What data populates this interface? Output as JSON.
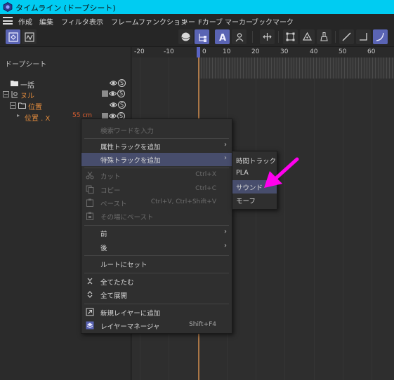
{
  "window": {
    "title": "タイムライン (ドープシート)"
  },
  "menubar": {
    "items": [
      "作成",
      "編集",
      "フィルタ",
      "表示",
      "フレーム",
      "ファンクション",
      "キー",
      "Fカーブ",
      "マーカー",
      "ブックマーク"
    ]
  },
  "panel": {
    "title": "ドープシート",
    "rows": [
      {
        "label": "一括"
      },
      {
        "label": "ヌル"
      },
      {
        "label": "位置"
      },
      {
        "label": "位置 . X",
        "value": "55 cm"
      }
    ],
    "s_glyph": "S"
  },
  "ruler": {
    "ticks": [
      "-20",
      "-10",
      "0",
      "10",
      "20",
      "30",
      "40",
      "50",
      "60"
    ]
  },
  "context_menu": {
    "search_placeholder": "検索ワードを入力",
    "items": [
      {
        "label": "属性トラックを追加",
        "submenu": true
      },
      {
        "label": "特殊トラックを追加",
        "submenu": true,
        "highlighted": true
      },
      {
        "label": "カット",
        "shortcut": "Ctrl+X",
        "disabled": true,
        "icon": "scissors-icon"
      },
      {
        "label": "コピー",
        "shortcut": "Ctrl+C",
        "disabled": true,
        "icon": "copy-icon"
      },
      {
        "label": "ペースト",
        "shortcut": "Ctrl+V, Ctrl+Shift+V",
        "disabled": true,
        "icon": "paste-icon"
      },
      {
        "label": "その場にペースト",
        "disabled": true,
        "icon": "paste-in-place-icon"
      },
      {
        "label": "前",
        "submenu": true
      },
      {
        "label": "後",
        "submenu": true
      },
      {
        "label": "ルートにセット"
      },
      {
        "label": "全てたたむ",
        "icon": "collapse-icon"
      },
      {
        "label": "全て展開",
        "icon": "expand-icon"
      },
      {
        "label": "新規レイヤーに追加",
        "icon": "new-layer-icon"
      },
      {
        "label": "レイヤーマネージャ",
        "shortcut": "Shift+F4",
        "icon": "layer-manager-icon"
      }
    ]
  },
  "submenu": {
    "items": [
      {
        "label": "時間トラック"
      },
      {
        "label": "PLA"
      },
      {
        "label": "サウンド",
        "highlighted": true
      },
      {
        "label": "モーフ"
      }
    ]
  },
  "colors": {
    "titlebar": "#00ccf2",
    "accent": "#5a64b4",
    "orange_text": "#e08a3c",
    "highlight": "#474d6c",
    "annotation_arrow": "#ff00ee"
  }
}
